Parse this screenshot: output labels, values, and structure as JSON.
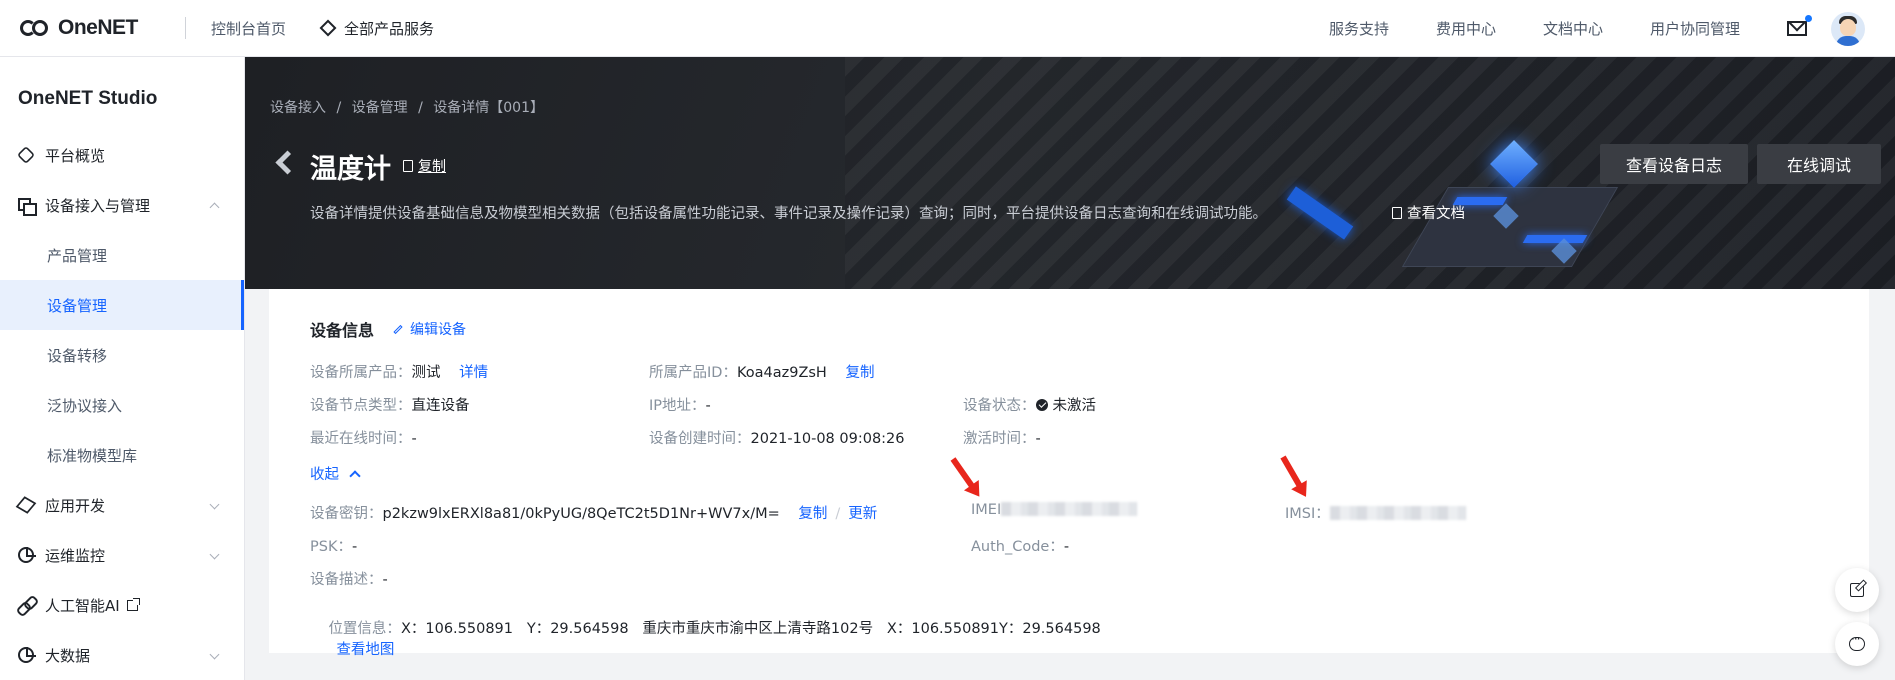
{
  "topbar": {
    "logo_text": "OneNET",
    "console_home": "控制台首页",
    "all_products": "全部产品服务",
    "nav": [
      "服务支持",
      "费用中心",
      "文档中心",
      "用户协同管理"
    ]
  },
  "sidebar": {
    "studio_title": "OneNET Studio",
    "items": [
      {
        "label": "平台概览",
        "icon": "overview-hex-icon"
      },
      {
        "label": "设备接入与管理",
        "icon": "device-icon",
        "expanded": true,
        "children": [
          "产品管理",
          "设备管理",
          "设备转移",
          "泛协议接入",
          "标准物模型库"
        ],
        "active_child": "设备管理"
      },
      {
        "label": "应用开发",
        "icon": "cube-icon"
      },
      {
        "label": "运维监控",
        "icon": "pie-icon"
      },
      {
        "label": "人工智能AI",
        "icon": "link-icon",
        "external": true
      },
      {
        "label": "大数据",
        "icon": "data-icon"
      }
    ]
  },
  "banner": {
    "breadcrumb": [
      "设备接入",
      "设备管理",
      "设备详情【001】"
    ],
    "breadcrumb_sep": "/",
    "title": "温度计",
    "copy": "复制",
    "description": "设备详情提供设备基础信息及物模型相关数据（包括设备属性功能记录、事件记录及操作记录）查询；同时，平台提供设备日志查询和在线调试功能。",
    "view_doc": "查看文档",
    "btn_log": "查看设备日志",
    "btn_debug": "在线调试"
  },
  "device_info": {
    "heading": "设备信息",
    "edit": "编辑设备",
    "product_label": "设备所属产品：",
    "product_value": "测试",
    "product_detail": "详情",
    "product_id_label": "所属产品ID：",
    "product_id_value": "Koa4az9ZsH",
    "product_id_copy": "复制",
    "node_type_label": "设备节点类型：",
    "node_type_value": "直连设备",
    "ip_label": "IP地址：",
    "ip_value": "-",
    "status_label": "设备状态：",
    "status_value": "未激活",
    "last_online_label": "最近在线时间：",
    "last_online_value": "-",
    "created_label": "设备创建时间：",
    "created_value": "2021-10-08 09:08:26",
    "activated_label": "激活时间：",
    "activated_value": "-",
    "collapse": "收起",
    "key_label": "设备密钥：",
    "key_value": "p2kzw9lxERXl8a81/0kPyUG/8QeTC2t5D1Nr+WV7x/M=",
    "key_copy": "复制",
    "key_sep": "/",
    "key_update": "更新",
    "imei_label": "IMEI",
    "imsi_label": "IMSI：",
    "psk_label": "PSK：",
    "psk_value": "-",
    "auth_label": "Auth_Code：",
    "auth_value": "-",
    "desc_label": "设备描述：",
    "desc_value": "-",
    "location_label": "位置信息：",
    "location_value": "X：106.550891   Y：29.564598   重庆市重庆市渝中区上清寺路102号   X：106.550891Y：29.564598",
    "view_map": "查看地图"
  },
  "colors": {
    "accent": "#1664ff",
    "banner_bg": "#26292e",
    "annotation_arrow": "#e8261c"
  }
}
